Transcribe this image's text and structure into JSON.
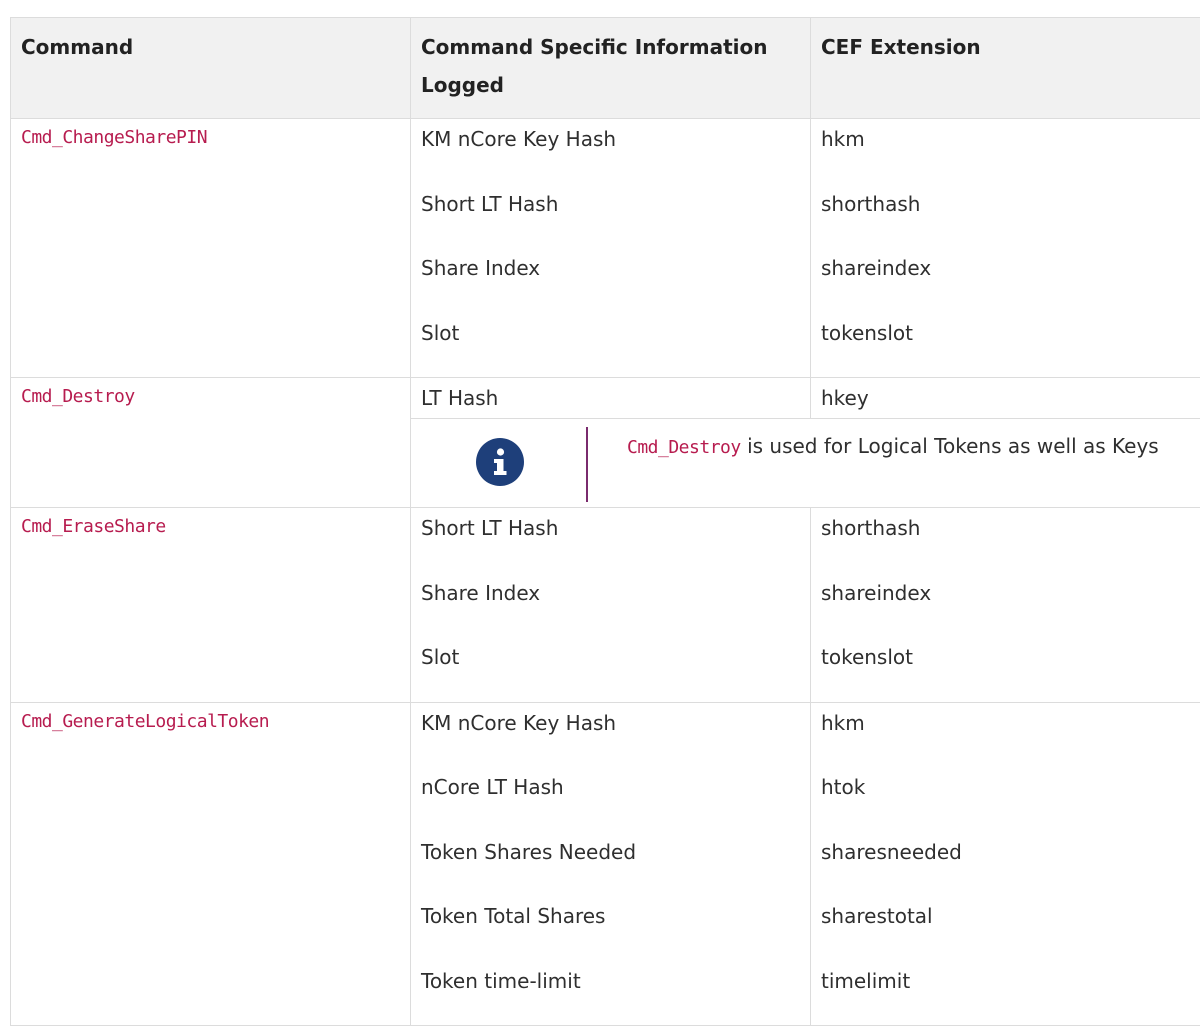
{
  "table": {
    "headers": {
      "command": "Command",
      "info": "Command Specific Information Logged",
      "cef": "CEF Extension"
    },
    "rows": [
      {
        "command": "Cmd_ChangeSharePIN",
        "entries": [
          {
            "info": "KM nCore Key Hash",
            "cef": "hkm"
          },
          {
            "info": "Short LT Hash",
            "cef": "shorthash"
          },
          {
            "info": "Share Index",
            "cef": "shareindex"
          },
          {
            "info": "Slot",
            "cef": "tokenslot"
          }
        ]
      },
      {
        "command": "Cmd_Destroy",
        "entries": [
          {
            "info": "LT Hash",
            "cef": "hkey"
          }
        ],
        "note": {
          "code": "Cmd_Destroy",
          "text": " is used for Logical Tokens as well as Keys",
          "icon": "info-icon"
        }
      },
      {
        "command": "Cmd_EraseShare",
        "entries": [
          {
            "info": "Short LT Hash",
            "cef": "shorthash"
          },
          {
            "info": "Share Index",
            "cef": "shareindex"
          },
          {
            "info": "Slot",
            "cef": "tokenslot"
          }
        ]
      },
      {
        "command": "Cmd_GenerateLogicalToken",
        "entries": [
          {
            "info": "KM nCore Key Hash",
            "cef": "hkm"
          },
          {
            "info": "nCore LT Hash",
            "cef": "htok"
          },
          {
            "info": "Token Shares Needed",
            "cef": "sharesneeded"
          },
          {
            "info": "Token Total Shares",
            "cef": "sharestotal"
          },
          {
            "info": "Token time-limit",
            "cef": "timelimit"
          }
        ]
      }
    ]
  },
  "colors": {
    "header_bg": "#f1f1f1",
    "border": "#dcdcdc",
    "code": "#b71c4f",
    "info_icon": "#1e3f7a",
    "note_bar": "#7a2b6d"
  }
}
